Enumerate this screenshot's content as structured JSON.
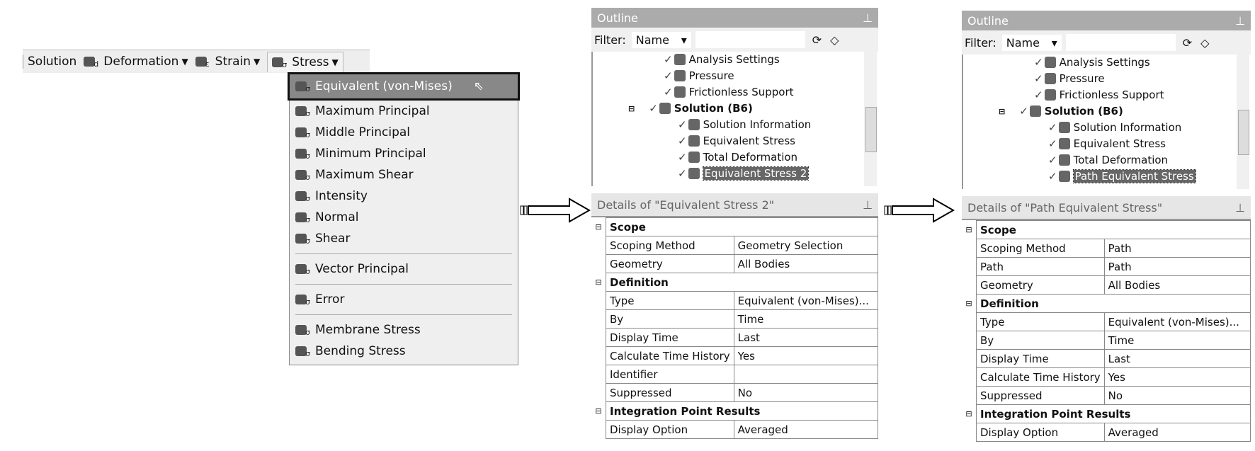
{
  "toolbar": {
    "solution": "Solution",
    "deformation": "Deformation",
    "strain": "Strain",
    "stress": "Stress"
  },
  "menu": {
    "items": [
      "Equivalent (von-Mises)",
      "Maximum Principal",
      "Middle Principal",
      "Minimum Principal",
      "Maximum Shear",
      "Intensity",
      "Normal",
      "Shear",
      "Vector Principal",
      "Error",
      "Membrane Stress",
      "Bending Stress"
    ]
  },
  "left": {
    "outline_title": "Outline",
    "filter_label": "Filter:",
    "filter_value": "Name",
    "tree": [
      "Analysis Settings",
      "Pressure",
      "Frictionless Support",
      "Solution (B6)",
      "Solution Information",
      "Equivalent Stress",
      "Total Deformation",
      "Equivalent Stress 2"
    ],
    "details_title": "Details of \"Equivalent Stress 2\"",
    "rows": [
      [
        "group",
        "Scope"
      ],
      [
        "Scoping Method",
        "Geometry Selection"
      ],
      [
        "Geometry",
        "All Bodies"
      ],
      [
        "group",
        "Definition"
      ],
      [
        "Type",
        "Equivalent (von-Mises)..."
      ],
      [
        "By",
        "Time"
      ],
      [
        "Display Time",
        "Last"
      ],
      [
        "Calculate Time History",
        "Yes"
      ],
      [
        "Identifier",
        ""
      ],
      [
        "Suppressed",
        "No"
      ],
      [
        "group",
        "Integration Point Results"
      ],
      [
        "Display Option",
        "Averaged"
      ]
    ]
  },
  "right": {
    "outline_title": "Outline",
    "filter_label": "Filter:",
    "filter_value": "Name",
    "tree": [
      "Analysis Settings",
      "Pressure",
      "Frictionless Support",
      "Solution (B6)",
      "Solution Information",
      "Equivalent Stress",
      "Total Deformation",
      "Path Equivalent Stress"
    ],
    "details_title": "Details of \"Path Equivalent Stress\"",
    "rows": [
      [
        "group",
        "Scope"
      ],
      [
        "Scoping Method",
        "Path"
      ],
      [
        "Path",
        "Path"
      ],
      [
        "Geometry",
        "All Bodies"
      ],
      [
        "group",
        "Definition"
      ],
      [
        "Type",
        "Equivalent (von-Mises)..."
      ],
      [
        "By",
        "Time"
      ],
      [
        "Display Time",
        "Last"
      ],
      [
        "Calculate Time History",
        "Yes"
      ],
      [
        "Suppressed",
        "No"
      ],
      [
        "group",
        "Integration Point Results"
      ],
      [
        "Display Option",
        "Averaged"
      ]
    ]
  }
}
